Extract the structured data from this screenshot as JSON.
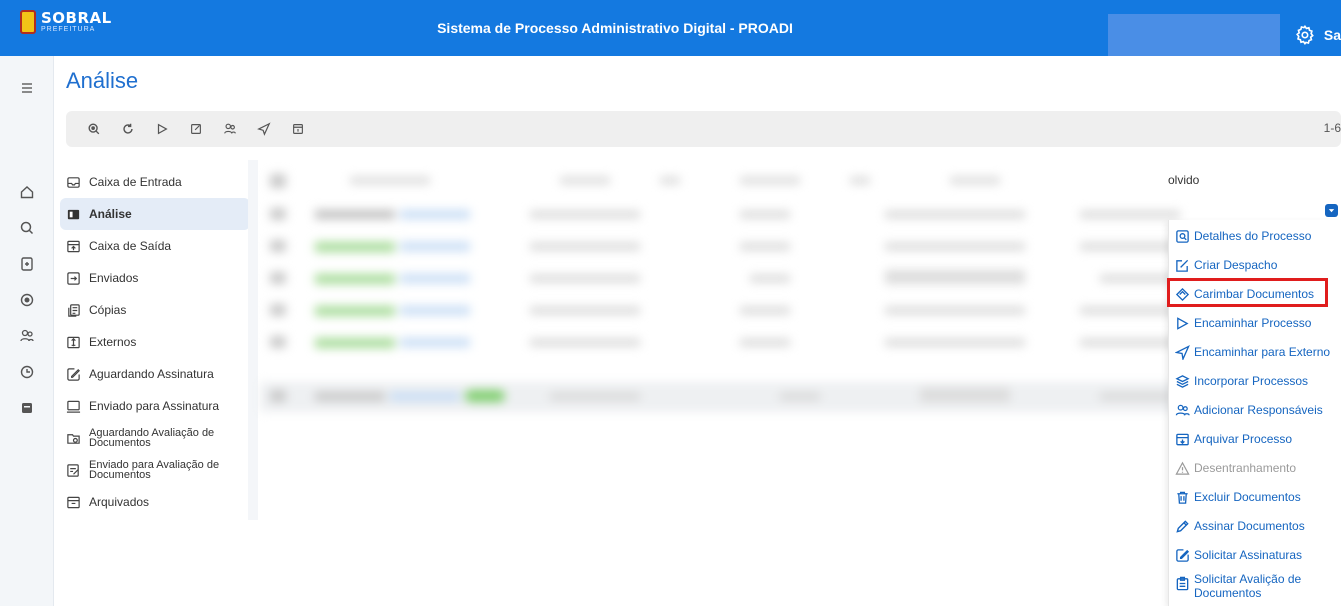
{
  "app": {
    "logo_main": "SOBRAL",
    "logo_sub": "PREFEITURA",
    "title": "Sistema de Processo Administrativo Digital - PROADI",
    "user_truncated": "Sa"
  },
  "page": {
    "title": "Análise",
    "pager_text": "1-6"
  },
  "rail_icons": [
    "menu-icon",
    "home-icon",
    "search-icon",
    "document-icon",
    "record-icon",
    "users-icon",
    "clock-icon",
    "archive-icon"
  ],
  "toolbar_icons": [
    "zoom-search-icon",
    "refresh-icon",
    "forward-icon",
    "edit-icon",
    "users-icon",
    "send-icon",
    "archive-icon"
  ],
  "folders": [
    {
      "label": "Caixa de Entrada",
      "icon": "inbox-icon"
    },
    {
      "label": "Análise",
      "icon": "analysis-icon",
      "active": true
    },
    {
      "label": "Caixa de Saída",
      "icon": "outbox-icon"
    },
    {
      "label": "Enviados",
      "icon": "sent-icon"
    },
    {
      "label": "Cópias",
      "icon": "copies-icon"
    },
    {
      "label": "Externos",
      "icon": "external-icon"
    },
    {
      "label": "Aguardando Assinatura",
      "icon": "awaiting-signature-icon"
    },
    {
      "label": "Enviado para Assinatura",
      "icon": "sent-signature-icon"
    },
    {
      "label": "Aguardando Avaliação de Documentos",
      "icon": "awaiting-evaluation-icon"
    },
    {
      "label": "Enviado para Avaliação de Documentos",
      "icon": "sent-evaluation-icon"
    },
    {
      "label": "Arquivados",
      "icon": "archived-icon"
    }
  ],
  "table": {
    "visible_header": "olvido"
  },
  "context_menu": {
    "items": [
      {
        "label": "Detalhes do Processo",
        "icon": "details-icon"
      },
      {
        "label": "Criar Despacho",
        "icon": "edit-icon"
      },
      {
        "label": "Carimbar Documentos",
        "icon": "stamp-icon",
        "highlighted": true
      },
      {
        "label": "Encaminhar Processo",
        "icon": "forward-icon"
      },
      {
        "label": "Encaminhar para Externo",
        "icon": "send-icon"
      },
      {
        "label": "Incorporar Processos",
        "icon": "layers-icon"
      },
      {
        "label": "Adicionar Responsáveis",
        "icon": "add-users-icon"
      },
      {
        "label": "Arquivar Processo",
        "icon": "archive-icon"
      },
      {
        "label": "Desentranhamento",
        "icon": "warning-icon",
        "disabled": true
      },
      {
        "label": "Excluir Documentos",
        "icon": "trash-icon"
      },
      {
        "label": "Assinar Documentos",
        "icon": "pen-icon"
      },
      {
        "label": "Solicitar Assinaturas",
        "icon": "sign-request-icon"
      },
      {
        "label": "Solicitar Avalição de Documentos",
        "icon": "evaluation-request-icon"
      }
    ]
  },
  "colors": {
    "topbar": "#1479e0",
    "accent": "#1565c0",
    "highlight_border": "#e01d1d"
  }
}
